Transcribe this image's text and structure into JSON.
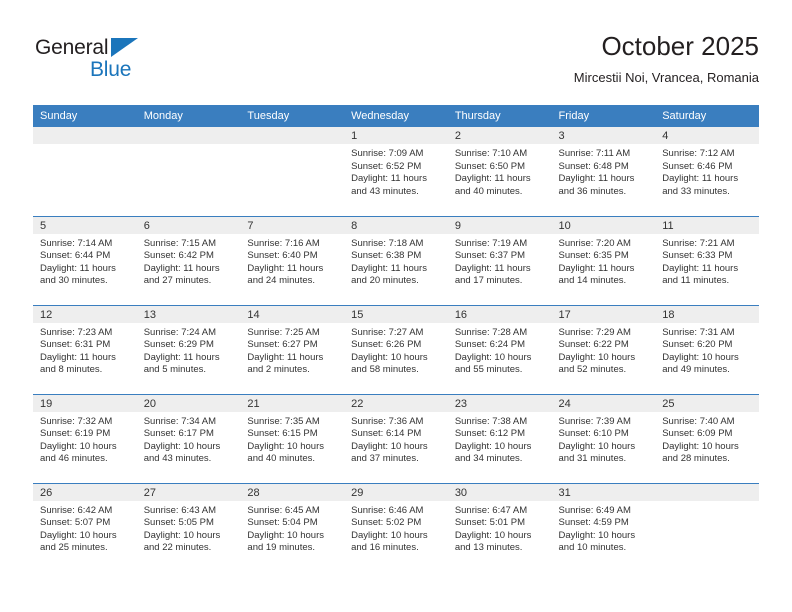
{
  "brand": {
    "name_top": "General",
    "name_bottom": "Blue",
    "triangle_color": "#1b75bb",
    "text_color": "#231f20"
  },
  "header": {
    "title": "October 2025",
    "subtitle": "Mircestii Noi, Vrancea, Romania"
  },
  "theme": {
    "header_row_background": "#3a7ebf",
    "header_row_text": "#ffffff",
    "daynum_background": "#eeeeee",
    "cell_background": "#ffffff",
    "row_divider": "#3a7ebf",
    "body_text": "#333333"
  },
  "weekdays": [
    "Sunday",
    "Monday",
    "Tuesday",
    "Wednesday",
    "Thursday",
    "Friday",
    "Saturday"
  ],
  "labels": {
    "sunrise_prefix": "Sunrise:",
    "sunset_prefix": "Sunset:",
    "daylight_prefix": "Daylight:"
  },
  "weeks": [
    [
      {
        "empty": true
      },
      {
        "empty": true
      },
      {
        "empty": true
      },
      {
        "day": "1",
        "sunrise": "Sunrise: 7:09 AM",
        "sunset": "Sunset: 6:52 PM",
        "daylight": "Daylight: 11 hours and 43 minutes."
      },
      {
        "day": "2",
        "sunrise": "Sunrise: 7:10 AM",
        "sunset": "Sunset: 6:50 PM",
        "daylight": "Daylight: 11 hours and 40 minutes."
      },
      {
        "day": "3",
        "sunrise": "Sunrise: 7:11 AM",
        "sunset": "Sunset: 6:48 PM",
        "daylight": "Daylight: 11 hours and 36 minutes."
      },
      {
        "day": "4",
        "sunrise": "Sunrise: 7:12 AM",
        "sunset": "Sunset: 6:46 PM",
        "daylight": "Daylight: 11 hours and 33 minutes."
      }
    ],
    [
      {
        "day": "5",
        "sunrise": "Sunrise: 7:14 AM",
        "sunset": "Sunset: 6:44 PM",
        "daylight": "Daylight: 11 hours and 30 minutes."
      },
      {
        "day": "6",
        "sunrise": "Sunrise: 7:15 AM",
        "sunset": "Sunset: 6:42 PM",
        "daylight": "Daylight: 11 hours and 27 minutes."
      },
      {
        "day": "7",
        "sunrise": "Sunrise: 7:16 AM",
        "sunset": "Sunset: 6:40 PM",
        "daylight": "Daylight: 11 hours and 24 minutes."
      },
      {
        "day": "8",
        "sunrise": "Sunrise: 7:18 AM",
        "sunset": "Sunset: 6:38 PM",
        "daylight": "Daylight: 11 hours and 20 minutes."
      },
      {
        "day": "9",
        "sunrise": "Sunrise: 7:19 AM",
        "sunset": "Sunset: 6:37 PM",
        "daylight": "Daylight: 11 hours and 17 minutes."
      },
      {
        "day": "10",
        "sunrise": "Sunrise: 7:20 AM",
        "sunset": "Sunset: 6:35 PM",
        "daylight": "Daylight: 11 hours and 14 minutes."
      },
      {
        "day": "11",
        "sunrise": "Sunrise: 7:21 AM",
        "sunset": "Sunset: 6:33 PM",
        "daylight": "Daylight: 11 hours and 11 minutes."
      }
    ],
    [
      {
        "day": "12",
        "sunrise": "Sunrise: 7:23 AM",
        "sunset": "Sunset: 6:31 PM",
        "daylight": "Daylight: 11 hours and 8 minutes."
      },
      {
        "day": "13",
        "sunrise": "Sunrise: 7:24 AM",
        "sunset": "Sunset: 6:29 PM",
        "daylight": "Daylight: 11 hours and 5 minutes."
      },
      {
        "day": "14",
        "sunrise": "Sunrise: 7:25 AM",
        "sunset": "Sunset: 6:27 PM",
        "daylight": "Daylight: 11 hours and 2 minutes."
      },
      {
        "day": "15",
        "sunrise": "Sunrise: 7:27 AM",
        "sunset": "Sunset: 6:26 PM",
        "daylight": "Daylight: 10 hours and 58 minutes."
      },
      {
        "day": "16",
        "sunrise": "Sunrise: 7:28 AM",
        "sunset": "Sunset: 6:24 PM",
        "daylight": "Daylight: 10 hours and 55 minutes."
      },
      {
        "day": "17",
        "sunrise": "Sunrise: 7:29 AM",
        "sunset": "Sunset: 6:22 PM",
        "daylight": "Daylight: 10 hours and 52 minutes."
      },
      {
        "day": "18",
        "sunrise": "Sunrise: 7:31 AM",
        "sunset": "Sunset: 6:20 PM",
        "daylight": "Daylight: 10 hours and 49 minutes."
      }
    ],
    [
      {
        "day": "19",
        "sunrise": "Sunrise: 7:32 AM",
        "sunset": "Sunset: 6:19 PM",
        "daylight": "Daylight: 10 hours and 46 minutes."
      },
      {
        "day": "20",
        "sunrise": "Sunrise: 7:34 AM",
        "sunset": "Sunset: 6:17 PM",
        "daylight": "Daylight: 10 hours and 43 minutes."
      },
      {
        "day": "21",
        "sunrise": "Sunrise: 7:35 AM",
        "sunset": "Sunset: 6:15 PM",
        "daylight": "Daylight: 10 hours and 40 minutes."
      },
      {
        "day": "22",
        "sunrise": "Sunrise: 7:36 AM",
        "sunset": "Sunset: 6:14 PM",
        "daylight": "Daylight: 10 hours and 37 minutes."
      },
      {
        "day": "23",
        "sunrise": "Sunrise: 7:38 AM",
        "sunset": "Sunset: 6:12 PM",
        "daylight": "Daylight: 10 hours and 34 minutes."
      },
      {
        "day": "24",
        "sunrise": "Sunrise: 7:39 AM",
        "sunset": "Sunset: 6:10 PM",
        "daylight": "Daylight: 10 hours and 31 minutes."
      },
      {
        "day": "25",
        "sunrise": "Sunrise: 7:40 AM",
        "sunset": "Sunset: 6:09 PM",
        "daylight": "Daylight: 10 hours and 28 minutes."
      }
    ],
    [
      {
        "day": "26",
        "sunrise": "Sunrise: 6:42 AM",
        "sunset": "Sunset: 5:07 PM",
        "daylight": "Daylight: 10 hours and 25 minutes."
      },
      {
        "day": "27",
        "sunrise": "Sunrise: 6:43 AM",
        "sunset": "Sunset: 5:05 PM",
        "daylight": "Daylight: 10 hours and 22 minutes."
      },
      {
        "day": "28",
        "sunrise": "Sunrise: 6:45 AM",
        "sunset": "Sunset: 5:04 PM",
        "daylight": "Daylight: 10 hours and 19 minutes."
      },
      {
        "day": "29",
        "sunrise": "Sunrise: 6:46 AM",
        "sunset": "Sunset: 5:02 PM",
        "daylight": "Daylight: 10 hours and 16 minutes."
      },
      {
        "day": "30",
        "sunrise": "Sunrise: 6:47 AM",
        "sunset": "Sunset: 5:01 PM",
        "daylight": "Daylight: 10 hours and 13 minutes."
      },
      {
        "day": "31",
        "sunrise": "Sunrise: 6:49 AM",
        "sunset": "Sunset: 4:59 PM",
        "daylight": "Daylight: 10 hours and 10 minutes."
      },
      {
        "empty": true
      }
    ]
  ]
}
